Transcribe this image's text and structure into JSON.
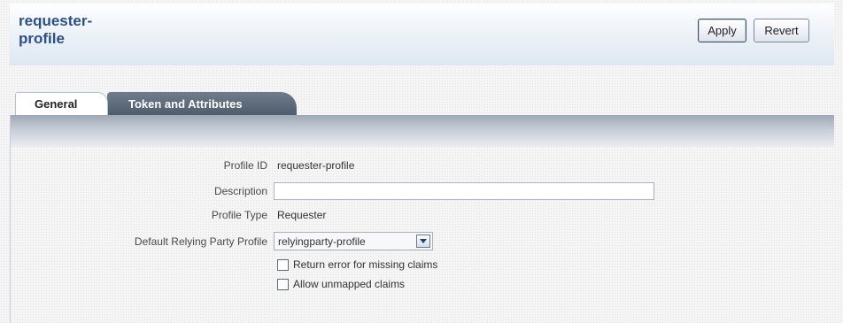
{
  "header": {
    "title": "requester-\nprofile",
    "apply_label": "Apply",
    "revert_label": "Revert"
  },
  "tabs": [
    {
      "label": "General",
      "selected": true
    },
    {
      "label": "Token and Attributes",
      "selected": false
    }
  ],
  "form": {
    "profile_id_label": "Profile ID",
    "profile_id_value": "requester-profile",
    "description_label": "Description",
    "description_value": "",
    "profile_type_label": "Profile Type",
    "profile_type_value": "Requester",
    "default_rp_label": "Default Relying Party Profile",
    "default_rp_value": "relyingparty-profile",
    "return_error_label": "Return error for missing claims",
    "return_error_checked": false,
    "allow_unmapped_label": "Allow unmapped claims",
    "allow_unmapped_checked": false
  },
  "icons": {
    "dropdown": "chevron-down-icon"
  },
  "colors": {
    "title": "#2a4f8a",
    "active_tab_bg": "#ffffff",
    "inactive_tab_bg": "#5a6777"
  }
}
